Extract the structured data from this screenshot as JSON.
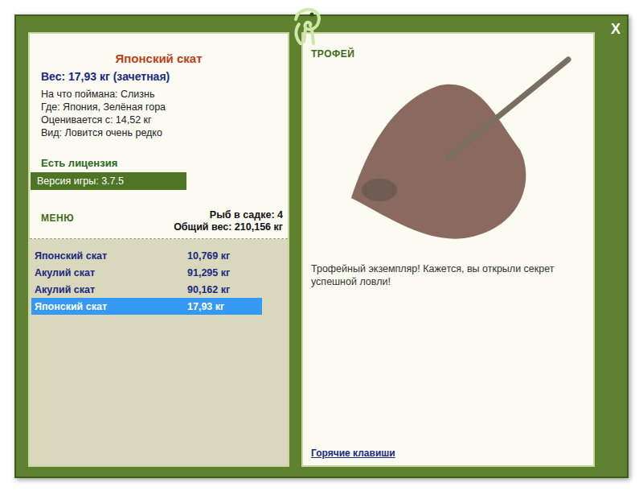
{
  "window": {
    "close": "X"
  },
  "fish": {
    "name": "Японский скат",
    "weight": "Вес: 17,93 кг (зачетная)",
    "details": [
      "На что поймана: Слизнь",
      "Где: Япония, Зелёная гора",
      "Оценивается с: 14,52 кг",
      "Вид: Ловится очень редко"
    ]
  },
  "license": "Есть лицензия",
  "version": "Версия игры: 3.7.5",
  "menu": "МЕНЮ",
  "keepnet": {
    "count": "Рыб в садке: 4",
    "total": "Общий вес: 210,156 кг"
  },
  "catches": [
    {
      "name": "Японский скат",
      "weight": "10,769 кг",
      "selected": false
    },
    {
      "name": "Акулий скат",
      "weight": "91,295 кг",
      "selected": false
    },
    {
      "name": "Акулий скат",
      "weight": "90,162 кг",
      "selected": false
    },
    {
      "name": "Японский скат",
      "weight": "17,93 кг",
      "selected": true
    }
  ],
  "trophy": {
    "label": "ТРОФЕЙ",
    "message": "Трофейный экземпляр! Кажется, вы открыли секрет успешной ловли!"
  },
  "hotkeys": "Горячие клавиши"
}
